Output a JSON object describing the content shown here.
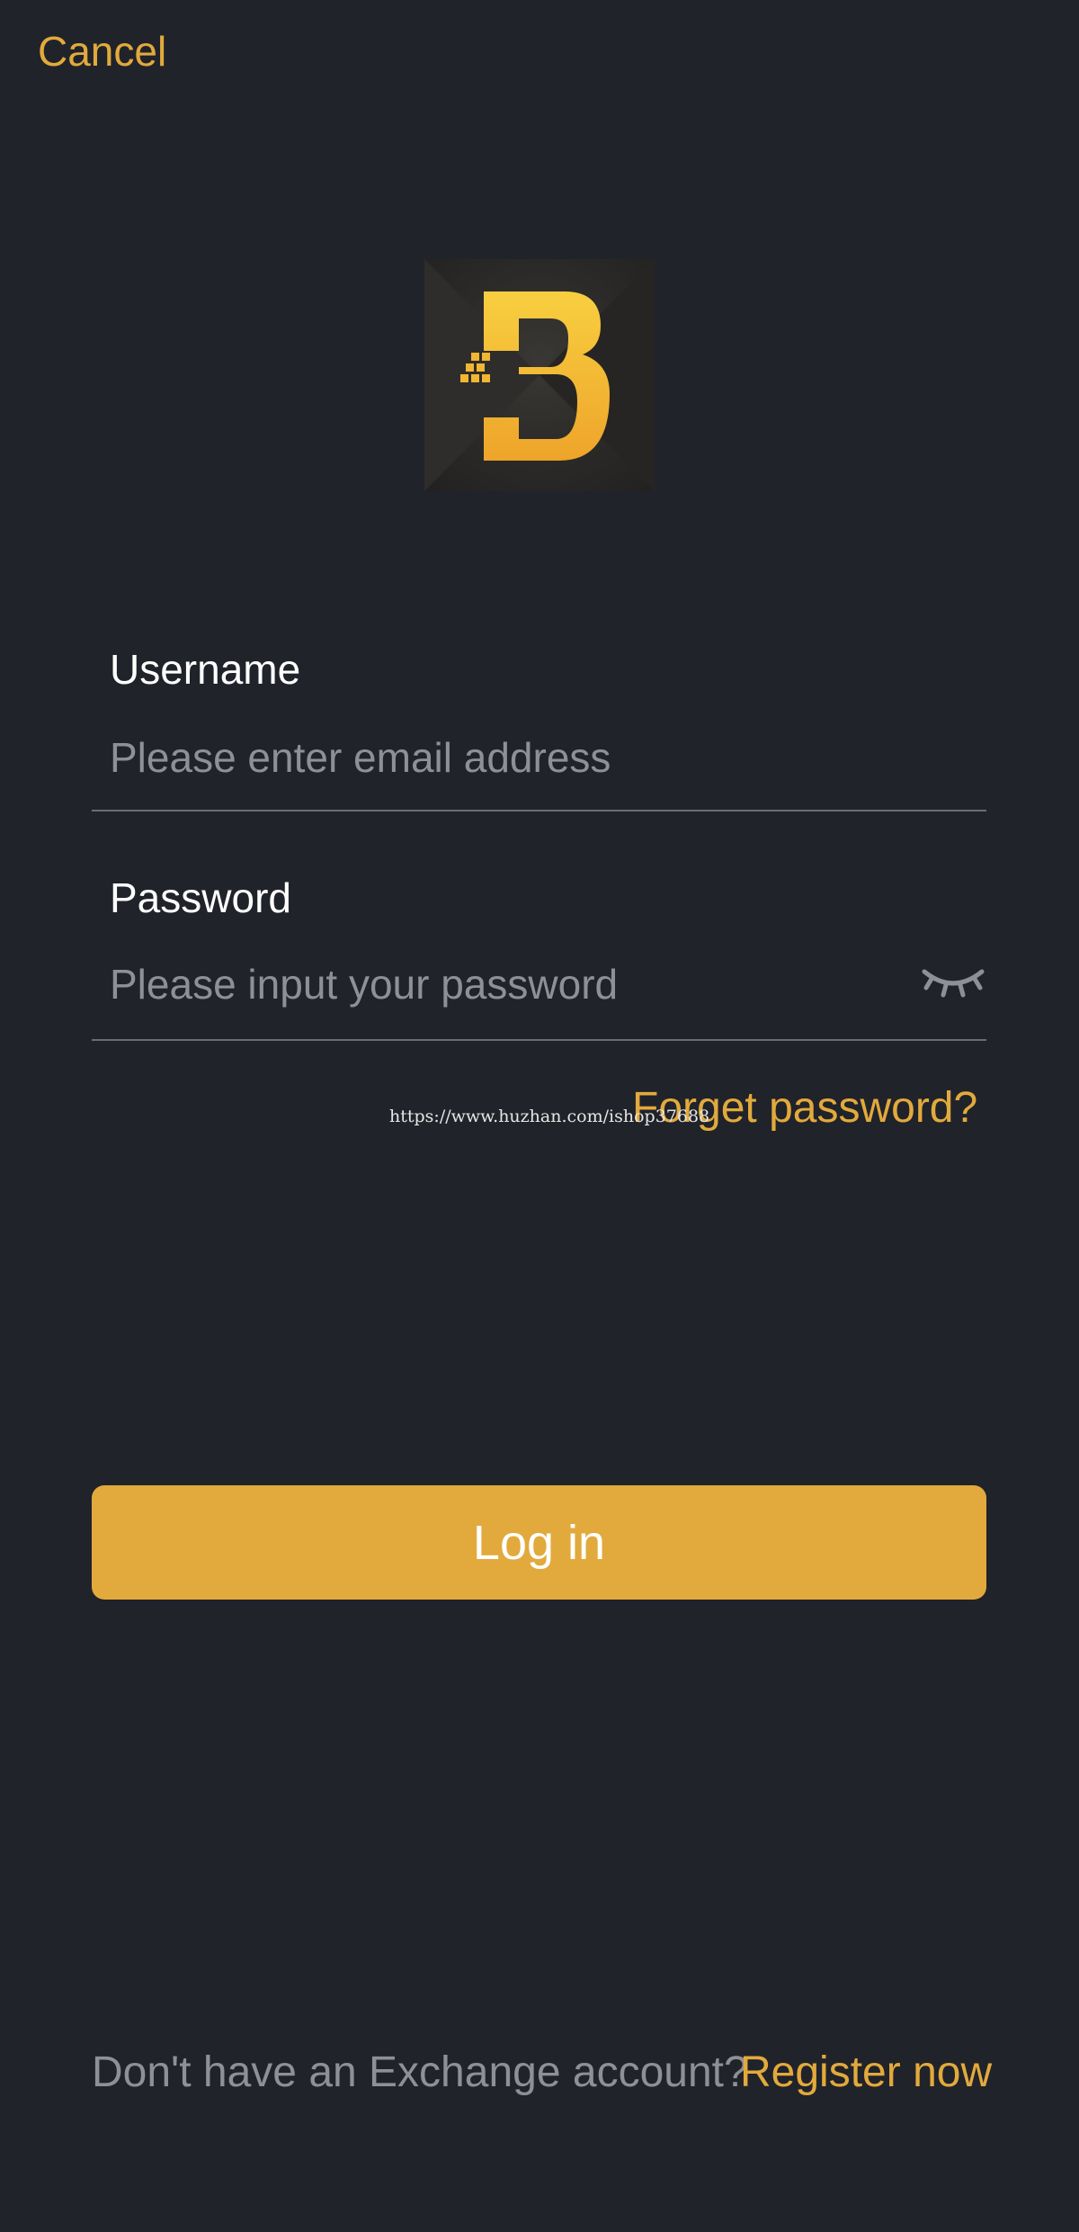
{
  "header": {
    "cancel_label": "Cancel"
  },
  "logo": {
    "icon": "bitcoin-b-logo",
    "accent": "#f1b632"
  },
  "form": {
    "username": {
      "label": "Username",
      "placeholder": "Please enter email address",
      "value": ""
    },
    "password": {
      "label": "Password",
      "placeholder": "Please input your password",
      "value": "",
      "toggle_icon": "eye-closed-icon"
    },
    "forget_label": "Forget password?"
  },
  "watermark": "https://www.huzhan.com/ishop37688",
  "actions": {
    "login_label": "Log in"
  },
  "footer": {
    "prompt": "Don't have an Exchange account?",
    "register_label": "Register now"
  },
  "colors": {
    "background": "#21232a",
    "accent": "#e2aa3c",
    "placeholder": "#8f9096",
    "divider": "#6b6d74"
  }
}
